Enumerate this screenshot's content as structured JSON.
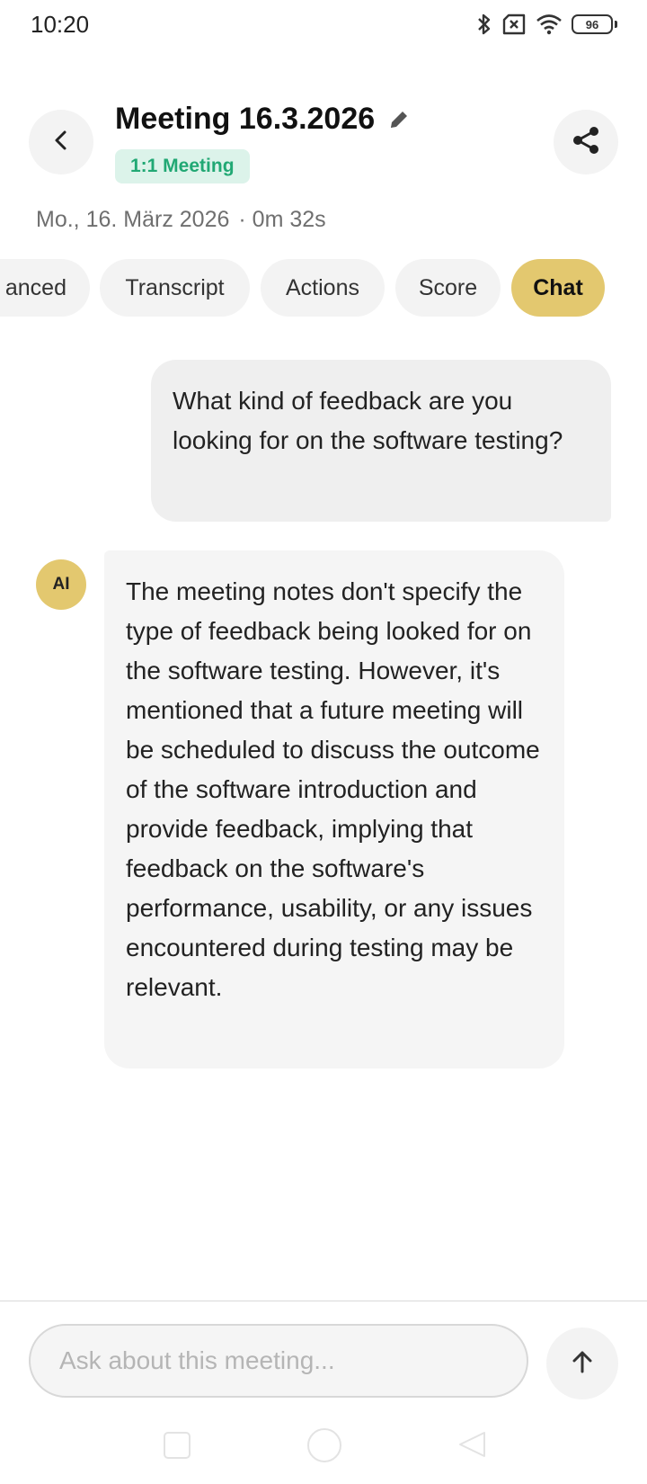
{
  "status_bar": {
    "time": "10:20",
    "battery_level": "96",
    "icons": [
      "bluetooth-icon",
      "no-sim-icon",
      "wifi-icon",
      "battery-icon"
    ]
  },
  "header": {
    "title": "Meeting 16.3.2026",
    "meeting_type": "1:1 Meeting",
    "date": "Mo., 16. März 2026",
    "duration": "· 0m 32s",
    "icons": [
      "back-chevron-icon",
      "edit-pencil-icon",
      "share-icon"
    ]
  },
  "tabs": [
    {
      "label": "anced",
      "active": false
    },
    {
      "label": "Transcript",
      "active": false
    },
    {
      "label": "Actions",
      "active": false
    },
    {
      "label": "Score",
      "active": false
    },
    {
      "label": "Chat",
      "active": true
    }
  ],
  "chat": {
    "messages": [
      {
        "role": "user",
        "text": "What kind of feedback are you looking for on the software testing?"
      },
      {
        "role": "assistant",
        "avatar": "AI",
        "text": "The meeting notes don't specify the type of feedback being looked for on the software testing. However, it's mentioned that a future meeting will be scheduled to discuss the outcome of the software introduction and provide feedback, implying that feedback on the software's performance, usability, or any issues encountered during testing may be relevant."
      }
    ]
  },
  "composer": {
    "placeholder": "Ask about this meeting...",
    "value": "",
    "send_icon": "arrow-up-icon"
  },
  "colors": {
    "accent": "#e3c86f",
    "badge_bg": "#dcf3ea",
    "badge_text": "#21a874",
    "bubble_user": "#efefef",
    "bubble_ai": "#f5f5f5"
  }
}
